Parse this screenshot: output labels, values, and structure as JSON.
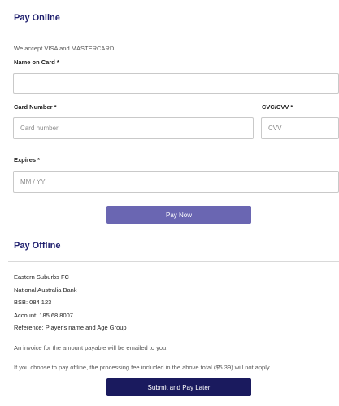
{
  "online": {
    "title": "Pay Online",
    "accept_text": "We accept VISA and MASTERCARD",
    "name_label": "Name on Card *",
    "name_value": "",
    "card_label": "Card Number *",
    "card_placeholder": "Card number",
    "cvc_label": "CVC/CVV *",
    "cvc_placeholder": "CVV",
    "expires_label": "Expires *",
    "expires_placeholder": "MM / YY",
    "pay_button": "Pay Now"
  },
  "offline": {
    "title": "Pay Offline",
    "lines": [
      "Eastern Suburbs FC",
      "National Australia Bank",
      "BSB: 084 123",
      "Account: 185 68 8007",
      "Reference: Player's name and Age Group"
    ],
    "invoice_note": "An invoice for the amount payable will be emailed to you.",
    "fee_note": "If you choose to pay offline, the processing fee included in the above total ($5.39) will not apply.",
    "submit_button": "Submit and Pay Later"
  },
  "colors": {
    "title": "#1f1f6e",
    "pay_button": "#6a66b2",
    "submit_button": "#1a1a5e"
  }
}
